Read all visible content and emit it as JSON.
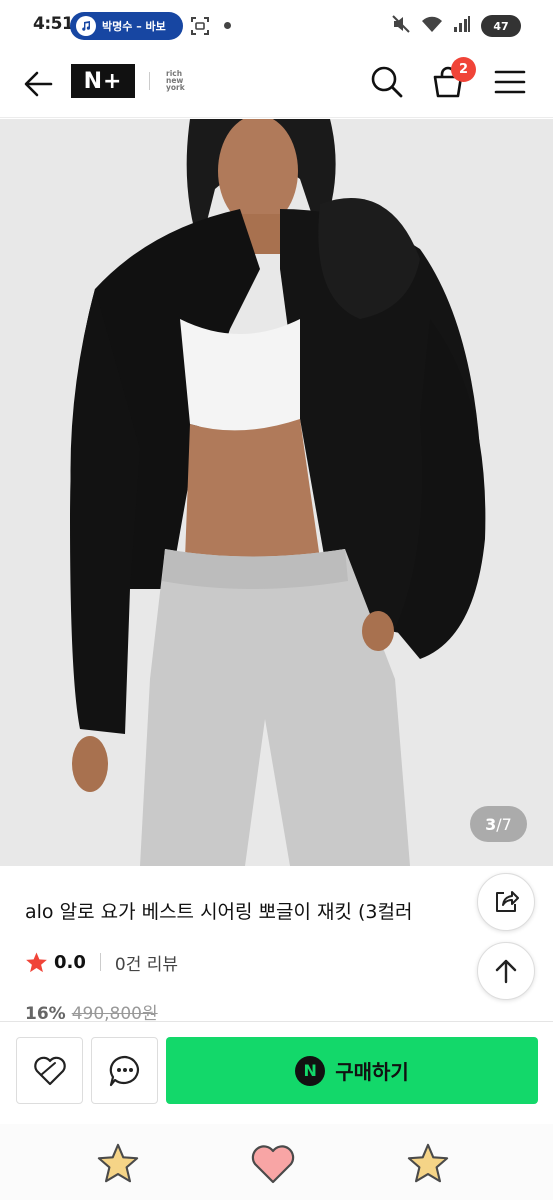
{
  "status_bar": {
    "time": "4:51",
    "media_text": "박명수 – 바보",
    "battery": "47"
  },
  "header": {
    "logo": "N+",
    "sub_logo": [
      "rich",
      "new",
      "york"
    ],
    "cart_count": "2"
  },
  "gallery": {
    "current": "3",
    "separator": " / ",
    "total": "7"
  },
  "product": {
    "title": "alo 알로 요가 베스트 시어링 뽀글이 재킷 (3컬러",
    "rating": "0.0",
    "review_count": "0건 리뷰",
    "discount": "16%",
    "original_price": "490,800원"
  },
  "purchase": {
    "buy_badge": "N",
    "buy_label": "구매하기"
  },
  "colors": {
    "buy_green": "#13d86a",
    "badge_red": "#f04438",
    "star_red": "#f04438",
    "media_blue": "#1746a2"
  },
  "icons": [
    "back-arrow-icon",
    "search-icon",
    "shopping-bag-icon",
    "hamburger-menu-icon",
    "share-icon",
    "arrow-up-icon",
    "heart-wish-icon",
    "chat-bubble-icon",
    "star-icon",
    "heart-icon"
  ]
}
